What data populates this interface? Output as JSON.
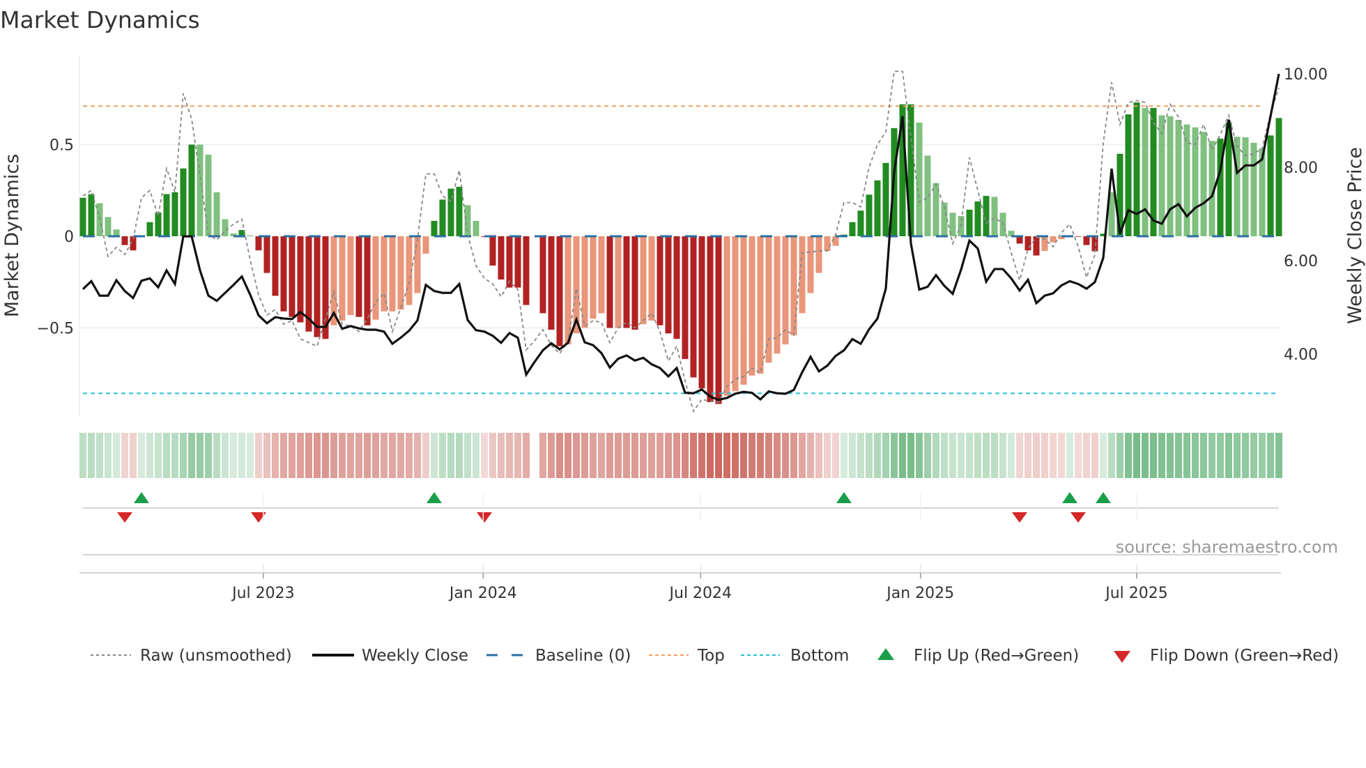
{
  "title": "Market Dynamics",
  "source": "source: sharemaestro.com",
  "legend": {
    "raw": "Raw (unsmoothed)",
    "close": "Weekly Close",
    "baseline": "Baseline (0)",
    "top": "Top",
    "bottom": "Bottom",
    "flip_up": "Flip Up (Red→Green)",
    "flip_down": "Flip Down (Green→Red)"
  },
  "colors": {
    "strong_green": "#228b22",
    "weak_green": "#80c080",
    "strong_red": "#b22222",
    "weak_red": "#e9967a",
    "raw": "#888888",
    "close": "#111111",
    "baseline": "#2a6fa0",
    "top": "#f0a060",
    "bottom": "#22c0d8",
    "flip_up": "#1a9e4a",
    "flip_down": "#d62728"
  },
  "chart_data": {
    "type": "bar",
    "title": "Market Dynamics",
    "ylabel": "Market Dynamics",
    "y2label": "Weekly Close Price",
    "ylim": [
      -0.99,
      0.99
    ],
    "y2lim": [
      2.66,
      10.4
    ],
    "start_date": "2023-01-31",
    "frequency": "weekly",
    "top_level": 0.71,
    "bottom_level": -0.857,
    "baseline": 0,
    "yticks": [
      {
        "value": 0.5,
        "label": "0.5"
      },
      {
        "value": 0,
        "label": "0"
      },
      {
        "value": -0.5,
        "label": "−0.5"
      }
    ],
    "y2ticks": [
      {
        "value": 10,
        "label": "10.00"
      },
      {
        "value": 8,
        "label": "8.00"
      },
      {
        "value": 6,
        "label": "6.00"
      },
      {
        "value": 4,
        "label": "4.00"
      }
    ],
    "xticks": [
      {
        "date": "2023-07-01",
        "label": "Jul 2023"
      },
      {
        "date": "2024-01-01",
        "label": "Jan 2024"
      },
      {
        "date": "2024-07-01",
        "label": "Jul 2024"
      },
      {
        "date": "2025-01-01",
        "label": "Jan 2025"
      },
      {
        "date": "2025-07-01",
        "label": "Jul 2025"
      }
    ],
    "dynamics": [
      0.21,
      0.23,
      0.18,
      0.105,
      0.037,
      -0.048,
      -0.077,
      0.003,
      0.077,
      0.13,
      0.23,
      0.24,
      0.37,
      0.5,
      0.5,
      0.445,
      0.24,
      0.093,
      0.015,
      0.034,
      0.005,
      -0.077,
      -0.2,
      -0.325,
      -0.41,
      -0.44,
      -0.47,
      -0.52,
      -0.55,
      -0.56,
      -0.486,
      -0.46,
      -0.43,
      -0.44,
      -0.486,
      -0.455,
      -0.41,
      -0.41,
      -0.4,
      -0.375,
      -0.31,
      -0.095,
      0.084,
      0.2,
      0.26,
      0.27,
      0.17,
      0.084,
      -0.004,
      -0.16,
      -0.236,
      -0.28,
      -0.28,
      -0.375,
      null,
      -0.42,
      -0.51,
      -0.6,
      -0.59,
      -0.53,
      -0.5,
      -0.45,
      -0.42,
      -0.5,
      -0.5,
      -0.5,
      -0.51,
      -0.48,
      -0.46,
      -0.486,
      -0.53,
      -0.56,
      -0.67,
      -0.77,
      -0.83,
      -0.905,
      -0.915,
      -0.87,
      -0.845,
      -0.81,
      -0.76,
      -0.75,
      -0.69,
      -0.64,
      -0.59,
      -0.54,
      -0.42,
      -0.31,
      -0.2,
      -0.08,
      -0.052,
      0.009,
      0.077,
      0.14,
      0.227,
      0.305,
      0.4,
      0.59,
      0.72,
      0.72,
      0.62,
      0.44,
      0.29,
      0.184,
      0.128,
      0.11,
      0.145,
      0.19,
      0.22,
      0.215,
      0.128,
      0.03,
      -0.04,
      -0.077,
      -0.105,
      -0.08,
      -0.033,
      -0.016,
      0.003,
      -0.003,
      -0.048,
      -0.082,
      0.014,
      0.24,
      0.45,
      0.665,
      0.73,
      0.7,
      0.7,
      0.66,
      0.655,
      0.635,
      0.61,
      0.594,
      0.57,
      0.52,
      0.533,
      0.62,
      0.543,
      0.54,
      0.51,
      0.48,
      0.55,
      0.645
    ],
    "strength": "SSWWWSSSSSSSSSWWWWWSWSSSSSSSSSWWWSSWWWWWWWSSSSWWSSSSSS-SSSWWWWWSWSSWWSSSSSSSSWWWWWWWWWWWWWWSSSSSSSSSWWWWWWSSSWWWSSSWWWSSSSSWSSSWSWWWWWWWSSWWWWSS",
    "raw": [
      0.22,
      0.25,
      0.1,
      -0.11,
      -0.06,
      -0.1,
      -0.016,
      0.21,
      0.25,
      0.11,
      0.37,
      0.24,
      0.78,
      0.64,
      0.33,
      0.01,
      -0.02,
      0.03,
      0.066,
      0.094,
      -0.13,
      -0.32,
      -0.43,
      -0.4,
      -0.48,
      -0.46,
      -0.56,
      -0.58,
      -0.6,
      -0.45,
      -0.3,
      -0.48,
      -0.49,
      -0.52,
      -0.45,
      -0.36,
      -0.31,
      -0.52,
      -0.39,
      -0.26,
      -0.016,
      0.34,
      0.34,
      0.22,
      0.19,
      0.36,
      0.01,
      -0.16,
      -0.23,
      -0.26,
      -0.33,
      -0.245,
      -0.29,
      -0.62,
      -0.57,
      -0.51,
      -0.595,
      -0.64,
      -0.575,
      -0.285,
      -0.49,
      -0.46,
      -0.47,
      -0.58,
      -0.5,
      -0.47,
      -0.5,
      -0.46,
      -0.42,
      -0.52,
      -0.68,
      -0.6,
      -0.79,
      -0.955,
      -0.89,
      -0.9,
      -0.905,
      -0.82,
      -0.78,
      -0.765,
      -0.72,
      -0.745,
      -0.56,
      -0.555,
      -0.51,
      -0.54,
      -0.09,
      -0.086,
      -0.08,
      -0.08,
      0.01,
      0.184,
      0.184,
      0.16,
      0.377,
      0.5,
      0.57,
      0.9,
      0.9,
      0.54,
      0.187,
      0.21,
      0.284,
      0.16,
      -0.04,
      0.06,
      0.43,
      0.25,
      0.072,
      0.1,
      0.072,
      -0.09,
      -0.24,
      -0.07,
      -0.004,
      -0.016,
      -0.057,
      0.02,
      0.066,
      -0.055,
      -0.225,
      -0.1,
      0.51,
      0.84,
      0.61,
      0.73,
      0.74,
      0.73,
      0.62,
      0.56,
      0.72,
      0.65,
      0.51,
      0.5,
      0.61,
      0.47,
      0.555,
      0.66,
      0.49,
      0.44,
      0.45,
      0.48,
      0.67,
      0.81
    ],
    "close": [
      5.39,
      5.56,
      5.25,
      5.25,
      5.58,
      5.35,
      5.2,
      5.57,
      5.62,
      5.43,
      5.79,
      5.5,
      6.52,
      6.52,
      5.79,
      5.25,
      5.14,
      5.31,
      5.48,
      5.66,
      5.27,
      4.83,
      4.66,
      4.79,
      4.76,
      4.75,
      4.9,
      4.76,
      4.58,
      4.58,
      4.88,
      4.54,
      4.6,
      4.55,
      4.52,
      4.52,
      4.48,
      4.22,
      4.35,
      4.5,
      4.72,
      5.48,
      5.35,
      5.31,
      5.31,
      5.5,
      4.73,
      4.51,
      4.48,
      4.39,
      4.24,
      4.45,
      4.35,
      3.56,
      3.83,
      4.08,
      4.23,
      4.1,
      4.24,
      4.74,
      4.25,
      4.19,
      4.02,
      3.71,
      3.9,
      3.97,
      3.86,
      3.92,
      3.78,
      3.7,
      3.52,
      3.7,
      3.17,
      3.16,
      3.24,
      3.09,
      3.02,
      3.06,
      3.15,
      3.19,
      3.17,
      3.03,
      3.2,
      3.16,
      3.15,
      3.23,
      3.61,
      3.94,
      3.63,
      3.75,
      3.96,
      4.08,
      4.32,
      4.22,
      4.53,
      4.76,
      5.4,
      7.9,
      9.09,
      6.37,
      5.38,
      5.44,
      5.69,
      5.46,
      5.29,
      5.81,
      6.43,
      6.26,
      5.55,
      5.82,
      5.82,
      5.62,
      5.36,
      5.59,
      5.09,
      5.25,
      5.3,
      5.47,
      5.56,
      5.5,
      5.4,
      5.54,
      6.06,
      7.97,
      6.57,
      7.08,
      7,
      7.1,
      6.86,
      6.79,
      7.1,
      7.21,
      6.95,
      7.13,
      7.23,
      7.38,
      7.93,
      9.02,
      7.88,
      8.04,
      8.04,
      8.17,
      9.09,
      10
    ],
    "flips_up_week": [
      8,
      43,
      92,
      119,
      123
    ],
    "flips_down_week": [
      6,
      22,
      49,
      113,
      120
    ]
  }
}
